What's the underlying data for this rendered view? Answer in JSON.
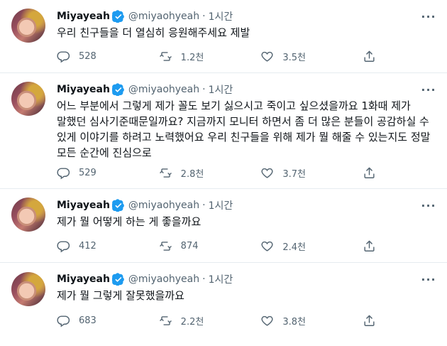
{
  "tweets": [
    {
      "name": "Miyayeah",
      "handle": "@miyaohyeah",
      "time": "1시간",
      "text": "우리 친구들을 더 열심히 응원해주세요 제발",
      "replies": "528",
      "retweets": "1.2천",
      "likes": "3.5천"
    },
    {
      "name": "Miyayeah",
      "handle": "@miyaohyeah",
      "time": "1시간",
      "text": "어느 부분에서 그렇게 제가 꼴도 보기 싫으시고 죽이고 싶으셨을까요 1화때 제가 말했던 심사기준때문일까요? 지금까지 모니터 하면서 좀 더 많은 분들이 공감하실 수 있게 이야기를 하려고 노력했어요 우리 친구들을 위해 제가 뭘 해줄 수 있는지도 정말 모든 순간에 진심으로",
      "replies": "529",
      "retweets": "2.8천",
      "likes": "3.7천"
    },
    {
      "name": "Miyayeah",
      "handle": "@miyaohyeah",
      "time": "1시간",
      "text": "제가 뭘 어떻게 하는 게 좋을까요",
      "replies": "412",
      "retweets": "874",
      "likes": "2.4천"
    },
    {
      "name": "Miyayeah",
      "handle": "@miyaohyeah",
      "time": "1시간",
      "text": "제가 뭘 그렇게 잘못했을까요",
      "replies": "683",
      "retweets": "2.2천",
      "likes": "3.8천"
    }
  ],
  "separator": "·",
  "icons": {
    "verified": "verified-badge-icon",
    "more": "more-options-icon",
    "reply": "reply-icon",
    "retweet": "retweet-icon",
    "like": "like-icon",
    "share": "share-icon"
  },
  "colors": {
    "verified": "#1d9bf0",
    "text": "#0f1419",
    "muted": "#536471",
    "divider": "#e6ecf0"
  }
}
